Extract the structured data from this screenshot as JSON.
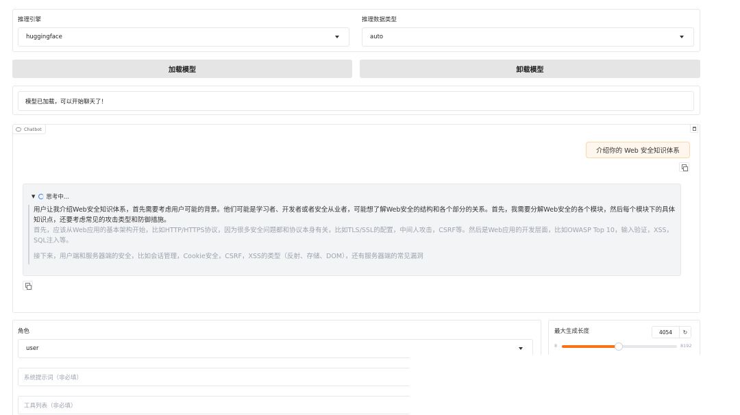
{
  "engine": {
    "label": "推理引擎",
    "value": "huggingface"
  },
  "dtype": {
    "label": "推理数据类型",
    "value": "auto"
  },
  "buttons": {
    "load": "加载模型",
    "unload": "卸载模型"
  },
  "status": {
    "text": "模型已加载，可以开始聊天了！"
  },
  "chatbot": {
    "badge": "Chatbot",
    "user_message": "介绍你的 Web 安全知识体系",
    "thinking": {
      "header": "思考中...",
      "para1": "用户让我介绍Web安全知识体系，首先需要考虑用户可能的背景。他们可能是学习者、开发者或者安全从业者，可能想了解Web安全的结构和各个部分的关系。首先，我需要分解Web安全的各个模块，然后每个模块下的具体知识点，还要考虑常见的攻击类型和防御措施。",
      "para2": "首先，应该从Web应用的基本架构开始，比如HTTP/HTTPS协议，因为很多安全问题都和协议本身有关，比如TLS/SSL的配置，中间人攻击，CSRF等。然后是Web应用的开发层面，比如OWASP Top 10，输入验证，XSS，SQL注入等。",
      "para3": "接下来，用户端和服务器端的安全，比如会话管理，Cookie安全，CSRF，XSS的类型（反射、存储、DOM），还有服务器端的常见漏洞"
    }
  },
  "role": {
    "label": "角色",
    "value": "user"
  },
  "system_prompt": {
    "placeholder": "系统提示词（非必填）"
  },
  "tools": {
    "placeholder": "工具列表（非必填）"
  },
  "max_length": {
    "label": "最大生成长度",
    "value": "4054",
    "min": "8",
    "max": "8192",
    "fraction": 0.494
  },
  "colors": {
    "accent": "#f97316",
    "button_bg": "#e5e5e5",
    "user_bubble": "#fff7ed",
    "thinking_bg": "#f3f4f6"
  }
}
